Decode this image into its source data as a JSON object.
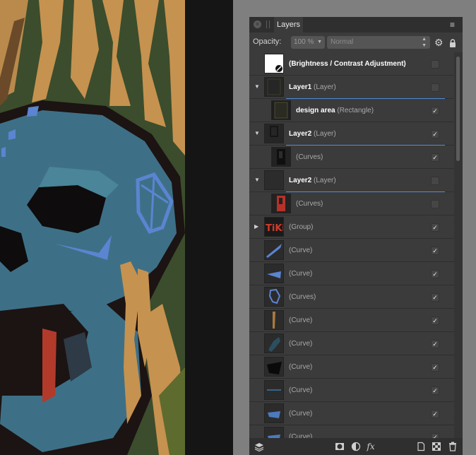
{
  "panel": {
    "tab_label": "Layers",
    "opacity_label": "Opacity:",
    "opacity_value": "100 %",
    "blend_mode": "Normal"
  },
  "layers": [
    {
      "name": "(Brightness / Contrast Adjustment)",
      "type": "",
      "checked": false,
      "expand": false,
      "indent": 0,
      "thumb": "adjustment",
      "accent": false
    },
    {
      "name": "Layer1",
      "type": "(Layer)",
      "checked": false,
      "expand": true,
      "indent": 0,
      "thumb": "layer1",
      "accent": true
    },
    {
      "name": "design area",
      "type": "(Rectangle)",
      "checked": true,
      "expand": false,
      "indent": 1,
      "thumb": "rect",
      "accent": false
    },
    {
      "name": "Layer2",
      "type": "(Layer)",
      "checked": true,
      "expand": true,
      "indent": 0,
      "thumb": "layer2a",
      "accent": true
    },
    {
      "name": "",
      "type": "(Curves)",
      "checked": true,
      "expand": false,
      "indent": 1,
      "thumb": "curves-dark",
      "accent": false
    },
    {
      "name": "Layer2",
      "type": "(Layer)",
      "checked": false,
      "expand": true,
      "indent": 0,
      "thumb": "empty",
      "accent": true
    },
    {
      "name": "",
      "type": "(Curves)",
      "checked": false,
      "expand": false,
      "indent": 1,
      "thumb": "curves-red",
      "accent": false
    },
    {
      "name": "",
      "type": "(Group)",
      "checked": true,
      "expand": "collapsed",
      "indent": 0,
      "thumb": "tiki",
      "accent": false
    },
    {
      "name": "",
      "type": "(Curve)",
      "checked": true,
      "expand": false,
      "indent": 0,
      "thumb": "blue-slash",
      "accent": false
    },
    {
      "name": "",
      "type": "(Curve)",
      "checked": true,
      "expand": false,
      "indent": 0,
      "thumb": "blue-wedge",
      "accent": false
    },
    {
      "name": "",
      "type": "(Curves)",
      "checked": true,
      "expand": false,
      "indent": 0,
      "thumb": "ear",
      "accent": false
    },
    {
      "name": "",
      "type": "(Curve)",
      "checked": true,
      "expand": false,
      "indent": 0,
      "thumb": "stripe",
      "accent": false
    },
    {
      "name": "",
      "type": "(Curve)",
      "checked": true,
      "expand": false,
      "indent": 0,
      "thumb": "teal",
      "accent": false
    },
    {
      "name": "",
      "type": "(Curve)",
      "checked": true,
      "expand": false,
      "indent": 0,
      "thumb": "black",
      "accent": false
    },
    {
      "name": "",
      "type": "(Curve)",
      "checked": true,
      "expand": false,
      "indent": 0,
      "thumb": "thin-blue",
      "accent": false
    },
    {
      "name": "",
      "type": "(Curve)",
      "checked": true,
      "expand": false,
      "indent": 0,
      "thumb": "blue-flat",
      "accent": false
    },
    {
      "name": "",
      "type": "(Curve)",
      "checked": true,
      "expand": false,
      "indent": 0,
      "thumb": "blue-flat",
      "accent": false
    }
  ],
  "icons": {
    "close": "close-icon",
    "grip": "grip-icon",
    "menu": "menu-icon",
    "gear": "gear-icon",
    "lock": "lock-icon"
  },
  "colors": {
    "accent": "#4f8dd9",
    "panel_bg": "#3b3b3b",
    "skull": "#3d7086",
    "stripe": "#c6924f"
  }
}
